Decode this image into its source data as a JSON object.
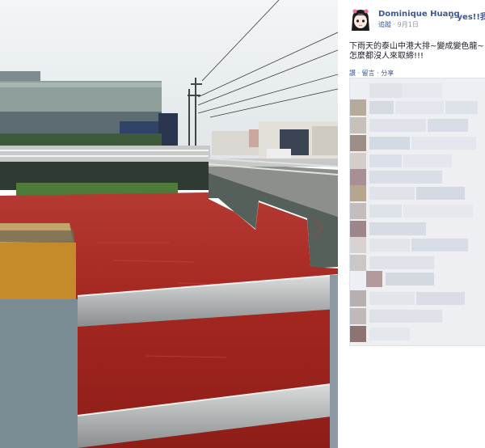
{
  "post": {
    "author": "Dominique Huang",
    "target": "yes!!我愛住",
    "follow_label": "追蹤",
    "date": "9月1日",
    "text": "下雨天的泰山中港大排~變成變色龍~怎麼都沒人來取締!!!",
    "actions": [
      "讚",
      "留言",
      "分享"
    ]
  },
  "colors": {
    "link": "#3b5998",
    "river": "#a92a22",
    "rail": "#b8bcbc"
  },
  "icons": [
    "avatar-anime-girl"
  ]
}
